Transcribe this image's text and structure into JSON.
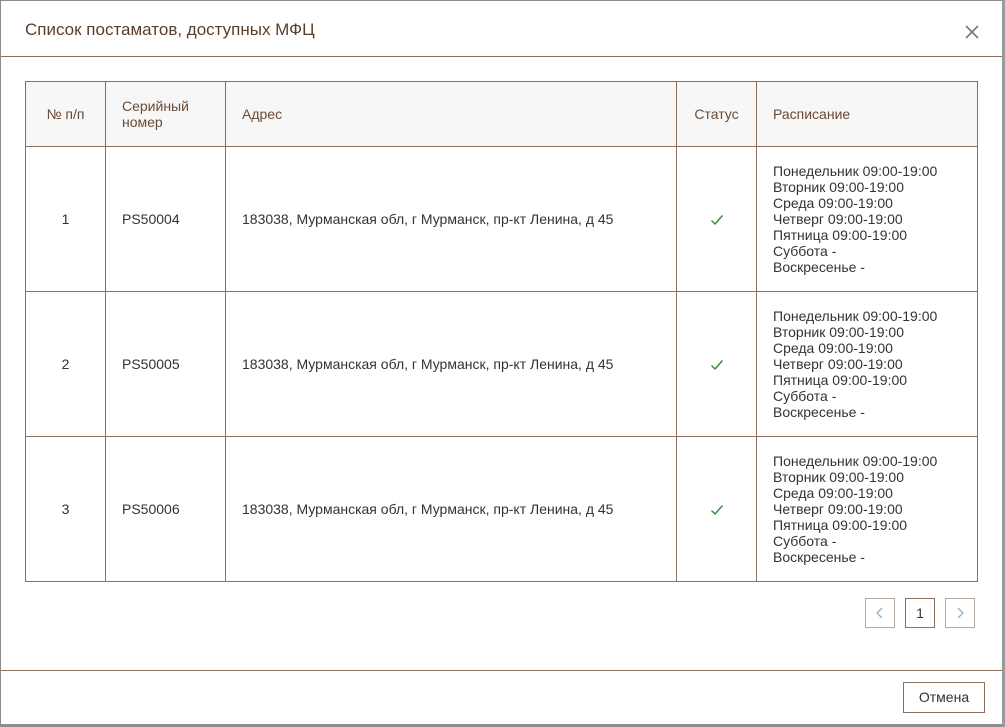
{
  "modal": {
    "title": "Список постаматов, доступных МФЦ",
    "close_icon": "close-icon"
  },
  "table": {
    "headers": {
      "num": "№ п/п",
      "serial": "Серийный номер",
      "address": "Адрес",
      "status": "Статус",
      "schedule": "Расписание"
    },
    "rows": [
      {
        "num": "1",
        "serial": "PS50004",
        "address": "183038, Мурманская обл, г Мурманск, пр-кт Ленина, д 45",
        "status_icon": "check-icon",
        "schedule": [
          "Понедельник 09:00-19:00",
          "Вторник 09:00-19:00",
          "Среда 09:00-19:00",
          "Четверг 09:00-19:00",
          "Пятница 09:00-19:00",
          "Суббота -",
          "Воскресенье -"
        ]
      },
      {
        "num": "2",
        "serial": "PS50005",
        "address": "183038, Мурманская обл, г Мурманск, пр-кт Ленина, д 45",
        "status_icon": "check-icon",
        "schedule": [
          "Понедельник 09:00-19:00",
          "Вторник 09:00-19:00",
          "Среда 09:00-19:00",
          "Четверг 09:00-19:00",
          "Пятница 09:00-19:00",
          "Суббота -",
          "Воскресенье -"
        ]
      },
      {
        "num": "3",
        "serial": "PS50006",
        "address": "183038, Мурманская обл, г Мурманск, пр-кт Ленина, д 45",
        "status_icon": "check-icon",
        "schedule": [
          "Понедельник 09:00-19:00",
          "Вторник 09:00-19:00",
          "Среда 09:00-19:00",
          "Четверг 09:00-19:00",
          "Пятница 09:00-19:00",
          "Суббота -",
          "Воскресенье -"
        ]
      }
    ]
  },
  "pagination": {
    "prev_icon": "chevron-left-icon",
    "current_page": "1",
    "next_icon": "chevron-right-icon"
  },
  "footer": {
    "cancel_label": "Отмена"
  },
  "colors": {
    "border": "#8b6f5c",
    "title_text": "#5a3e2b",
    "header_bg": "#f7f7f7",
    "check": "#2e8b2e"
  }
}
